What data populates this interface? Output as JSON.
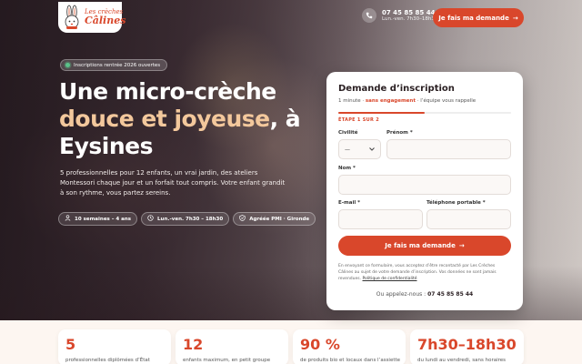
{
  "header": {
    "logo_line1": "Les crèches",
    "logo_line2": "Câlines",
    "phone": "07 45 85 85 44",
    "hours": "Lun.-ven. 7h30–18h30",
    "cta": "Je fais ma demande"
  },
  "hero": {
    "badge": "Inscriptions rentrée 2026 ouvertes",
    "title_line1": "Une micro-crèche",
    "title_accent": "douce et joyeuse",
    "title_after_accent": ", à",
    "title_line3": "Eysines",
    "lede": "5 professionnelles pour 12 enfants, un vrai jardin, des ateliers Montessori chaque jour et un forfait tout compris. Votre enfant grandit à son rythme, vous partez sereins.",
    "chips": [
      {
        "icon": "child-icon",
        "label": "10 semaines – 4 ans"
      },
      {
        "icon": "clock-icon",
        "label": "Lun.-ven. 7h30 – 18h30"
      },
      {
        "icon": "shield-check-icon",
        "label": "Agréée PMI · Gironde"
      }
    ]
  },
  "form": {
    "title": "Demande d’inscription",
    "subtitle_pre": "1 minute · ",
    "subtitle_bold": "sans engagement",
    "subtitle_post": " · l’équipe vous rappelle",
    "progress": 0.5,
    "step": "ÉTAPE 1 SUR 2",
    "civility_label": "Civilité",
    "civility_value": "—",
    "firstname_label": "Prénom *",
    "name_label": "Nom *",
    "email_label": "E-mail *",
    "mobile_label": "Téléphone portable *",
    "submit": "Je fais ma demande",
    "legal_text": "En envoyant ce formulaire, vous acceptez d’être recontacté par Les Crèches Câlines au sujet de votre demande d’inscription. Vos données ne sont jamais revendues.",
    "legal_link": "Politique de confidentialité",
    "callus_pre": "Ou appelez-nous : ",
    "callus_phone": "07 45 85 85 44"
  },
  "stats": [
    {
      "value": "5",
      "label": "professionnelles diplômées d’État"
    },
    {
      "value": "12",
      "label": "enfants maximum, en petit groupe"
    },
    {
      "value": "90 %",
      "label": "de produits bio et locaux dans l’assiette"
    },
    {
      "value": "7h30–18h30",
      "label": "du lundi au vendredi, sans horaires"
    }
  ],
  "colors": {
    "accent": "#d9472b",
    "highlight": "#f3c89c"
  }
}
